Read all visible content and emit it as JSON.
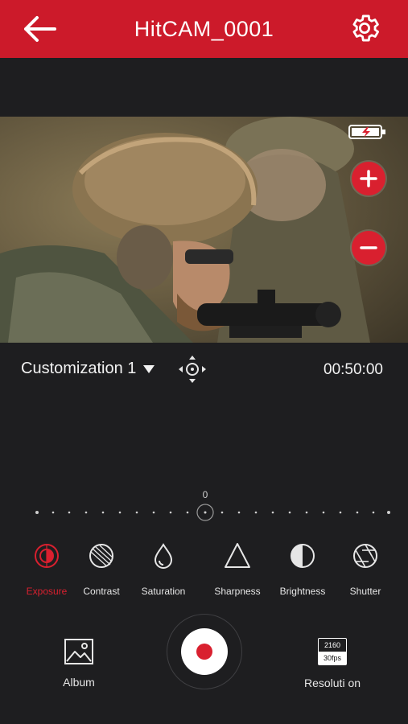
{
  "header": {
    "title": "HitCAM_0001",
    "back_icon": "arrow-left-icon",
    "settings_icon": "gear-icon"
  },
  "preview": {
    "battery_icon": "battery-charging-icon",
    "zoom_in_icon": "plus-icon",
    "zoom_out_icon": "minus-icon"
  },
  "controls": {
    "profile_label": "Customization 1",
    "move_icon": "move-crosshair-icon",
    "timer": "00:50:00",
    "slider_value": "0"
  },
  "tools": [
    {
      "label": "Exposure",
      "icon": "exposure-icon",
      "active": true
    },
    {
      "label": "Contrast",
      "icon": "contrast-icon",
      "active": false
    },
    {
      "label": "Saturation",
      "icon": "droplet-icon",
      "active": false
    },
    {
      "label": "Sharpness",
      "icon": "triangle-icon",
      "active": false
    },
    {
      "label": "Brightness",
      "icon": "brightness-icon",
      "active": false
    },
    {
      "label": "Shutter",
      "icon": "aperture-icon",
      "active": false
    }
  ],
  "bottom": {
    "album_label": "Album",
    "resolution_label": "Resoluti on",
    "resolution_top": "2160",
    "resolution_bottom": "30fps"
  },
  "colors": {
    "accent": "#d9202f",
    "header_bg": "#cc1a2a",
    "background": "#1e1e20"
  }
}
